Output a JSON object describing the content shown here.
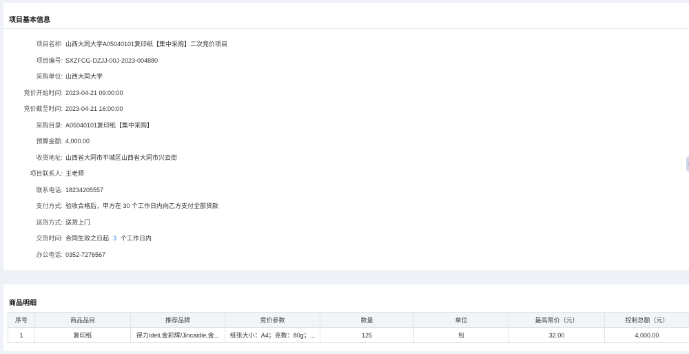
{
  "basic_info": {
    "title": "项目基本信息",
    "rows": [
      {
        "label": "项目名称:",
        "value": "山西大同大学A05040101复印纸【集中采购】二次竞价项目"
      },
      {
        "label": "项目编号:",
        "value": "SXZFCG-DZJJ-00J-2023-004880"
      },
      {
        "label": "采购单位:",
        "value": "山西大同大学"
      },
      {
        "label": "竞价开始时间:",
        "value": "2023-04-21 09:00:00"
      },
      {
        "label": "竞价截至时间:",
        "value": "2023-04-21 16:00:00"
      },
      {
        "label": "采购目录:",
        "value": "A05040101复印纸【集中采购】"
      },
      {
        "label": "预算金额:",
        "value": "4,000.00"
      },
      {
        "label": "收货地址:",
        "value": "山西省大同市平城区山西省大同市兴云街"
      },
      {
        "label": "项目联系人:",
        "value": "王老师"
      },
      {
        "label": "联系电话:",
        "value": "18234205557"
      },
      {
        "label": "支付方式:",
        "value": "验收合格后，甲方在 30 个工作日内向乙方支付全部货款"
      },
      {
        "label": "送货方式:",
        "value": "送货上门"
      }
    ],
    "delivery": {
      "label": "交货时间:",
      "prefix": "合同生效之日起",
      "days": "3",
      "suffix": "个工作日内"
    },
    "office_phone": {
      "label": "办公电话:",
      "value": "0352-7276567"
    }
  },
  "goods": {
    "title": "商品明细",
    "columns": [
      "序号",
      "商品品目",
      "推荐品牌",
      "竞价参数",
      "数量",
      "单位",
      "最高限价（元）",
      "控制总额（元）"
    ],
    "rows": [
      {
        "seq": "1",
        "item": "复印纸",
        "brand": "得力/deli,金彩辉/Jincaidie,金...",
        "params": "纸张大小：A4；克数：80g；...",
        "qty": "125",
        "unit": "包",
        "max_price": "32.00",
        "total": "4,000.00"
      }
    ]
  },
  "side_handle": {
    "icon": "chevron-right-icon",
    "glyph": "›"
  }
}
